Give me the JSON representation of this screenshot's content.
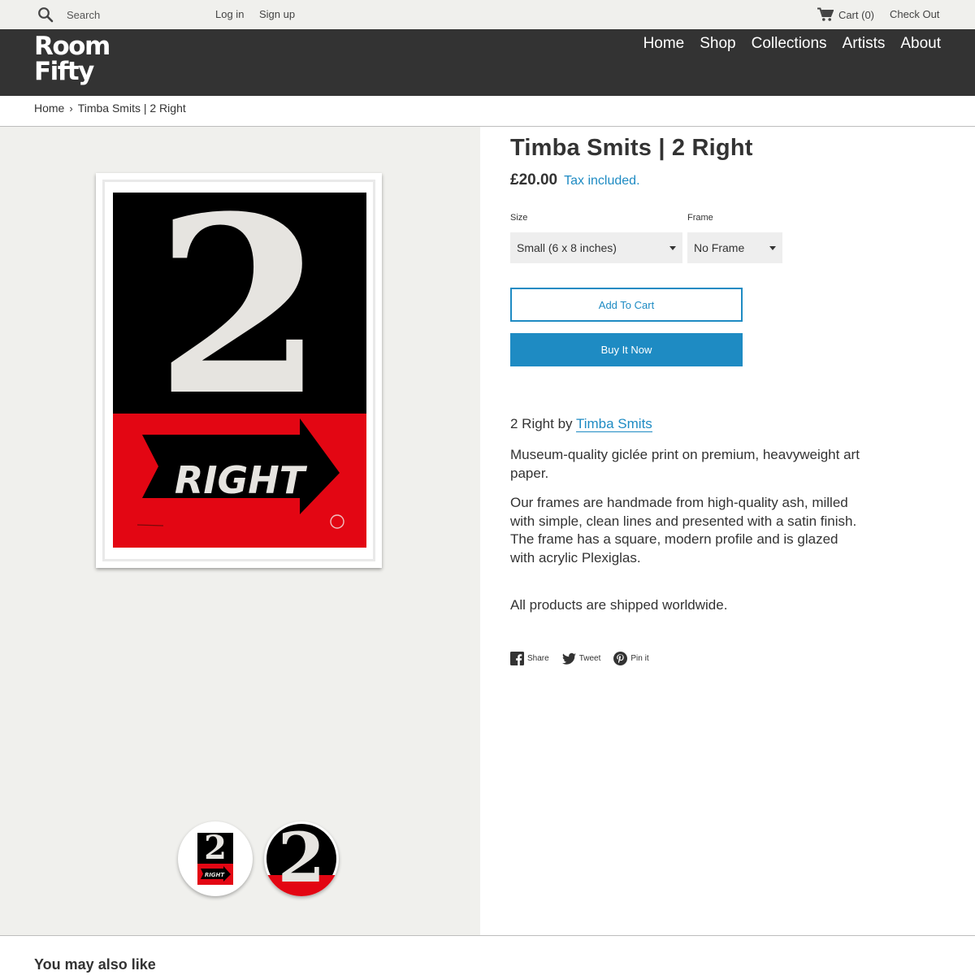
{
  "topbar": {
    "search_placeholder": "Search",
    "login": "Log in",
    "signup": "Sign up",
    "cart": "Cart (0)",
    "checkout": "Check Out"
  },
  "header": {
    "logo_line1": "Room",
    "logo_line2": "Fifty",
    "nav": [
      "Home",
      "Shop",
      "Collections",
      "Artists",
      "About"
    ]
  },
  "breadcrumb": {
    "home": "Home",
    "separator": "›",
    "current": "Timba Smits | 2 Right"
  },
  "product": {
    "title": "Timba Smits | 2 Right",
    "price": "£20.00",
    "tax_note": "Tax included.",
    "size_label": "Size",
    "size_value": "Small (6 x 8 inches)",
    "frame_label": "Frame",
    "frame_value": "No Frame",
    "add_to_cart": "Add To Cart",
    "buy_now": "Buy It Now",
    "by_prefix": "2 Right by ",
    "artist": "Timba Smits",
    "desc_1": "Museum-quality giclée print on premium, heavyweight art paper.",
    "desc_2": "Our frames are handmade from high-quality ash, milled with simple, clean lines and presented with a satin finish. The frame has a square, modern profile and is glazed with acrylic Plexiglas.",
    "desc_3": "All products are shipped worldwide."
  },
  "artwork": {
    "numeral": "2",
    "arrow_text": "RIGHT",
    "colors": {
      "top": "#000000",
      "bottom": "#e30613",
      "numeral": "#e6e4e0"
    }
  },
  "share": {
    "facebook": "Share",
    "twitter": "Tweet",
    "pinterest": "Pin it"
  },
  "related": {
    "heading": "You may also like"
  },
  "colors": {
    "accent": "#1e8bc3",
    "header_bg": "#333333",
    "topbar_bg": "#f0f0ed"
  },
  "icons": [
    "search-icon",
    "cart-icon",
    "chevron-down-icon",
    "facebook-icon",
    "twitter-icon",
    "pinterest-icon"
  ]
}
